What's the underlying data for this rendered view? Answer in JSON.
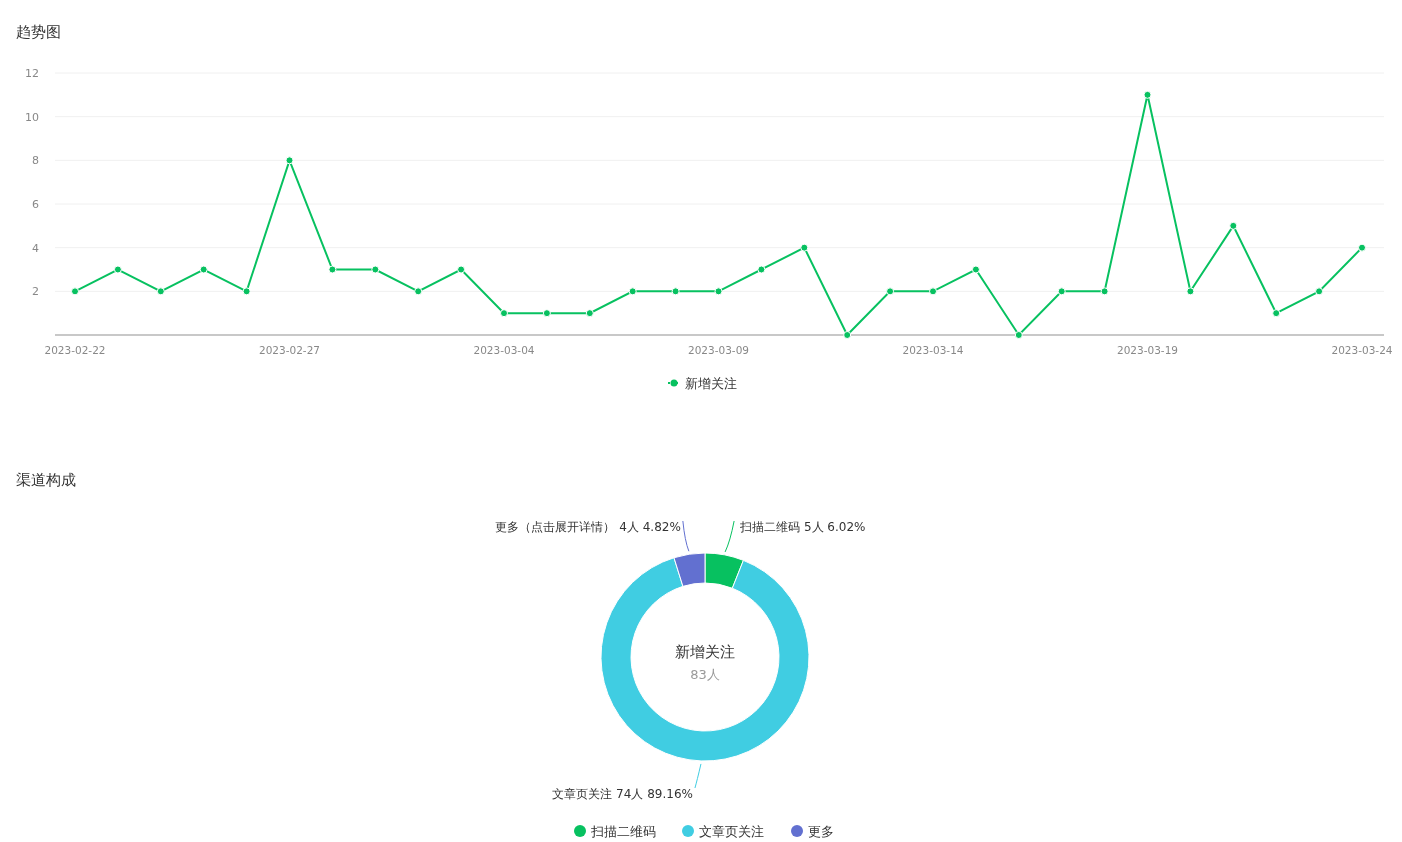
{
  "trend": {
    "title": "趋势图",
    "chart_data": {
      "type": "line",
      "grid": true,
      "legend": true,
      "categories": [
        "2023-02-22",
        null,
        null,
        null,
        null,
        "2023-02-27",
        null,
        null,
        null,
        null,
        "2023-03-04",
        null,
        null,
        null,
        null,
        "2023-03-09",
        null,
        null,
        null,
        null,
        "2023-03-14",
        null,
        null,
        null,
        null,
        "2023-03-19",
        null,
        null,
        null,
        null,
        "2023-03-24"
      ],
      "series": [
        {
          "name": "新增关注",
          "color": "#07c160",
          "marker": "circle",
          "values": [
            2,
            3,
            2,
            3,
            2,
            8,
            3,
            3,
            2,
            3,
            1,
            1,
            1,
            2,
            2,
            2,
            3,
            4,
            0,
            2,
            2,
            3,
            0,
            2,
            2,
            11,
            2,
            5,
            1,
            2,
            4
          ]
        }
      ],
      "ylim": [
        0,
        12
      ],
      "yticks": [
        2,
        4,
        6,
        8,
        10,
        12
      ]
    }
  },
  "channels": {
    "title": "渠道构成",
    "center_title": "新增关注",
    "center_value": "83人",
    "chart_data": {
      "type": "donut",
      "legend": true,
      "categories": [
        "扫描二维码",
        "文章页关注",
        "更多"
      ],
      "series": [
        {
          "values": [
            6.02,
            89.16,
            4.82
          ]
        }
      ],
      "colors": [
        "#07c160",
        "#40cde2",
        "#6270d0"
      ],
      "value_labels": [
        "扫描二维码 5人 6.02%",
        "文章页关注 74人 89.16%",
        "更多（点击展开详情） 4人 4.82%"
      ]
    }
  }
}
